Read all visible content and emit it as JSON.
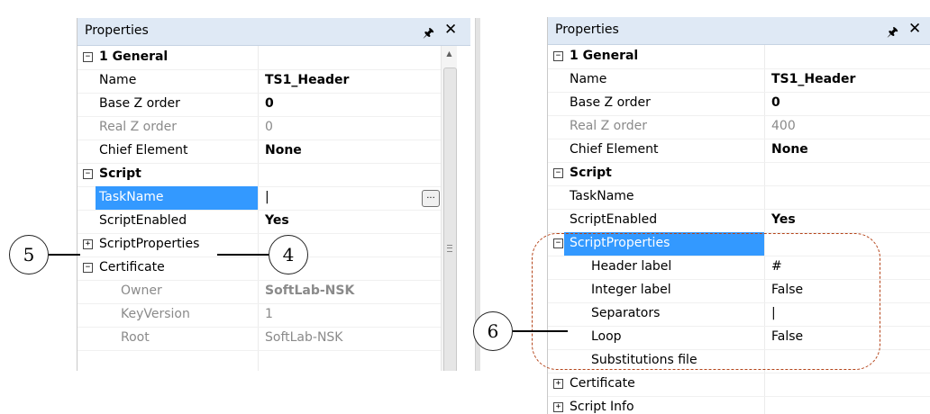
{
  "left_panel": {
    "title": "Properties",
    "pin_icon": "pin-icon",
    "close_icon": "close-icon",
    "rows": [
      {
        "type": "category",
        "name": "1 General",
        "expander": "−"
      },
      {
        "type": "prop",
        "name": "Name",
        "value": "TS1_Header",
        "value_bold": true
      },
      {
        "type": "prop",
        "name": "Base Z order",
        "value": "0",
        "value_bold": true
      },
      {
        "type": "prop",
        "name": "Real Z order",
        "value": "0",
        "grey": true
      },
      {
        "type": "prop",
        "name": "Chief Element",
        "value": "None",
        "value_bold": true
      },
      {
        "type": "category",
        "name": "Script",
        "expander": "−"
      },
      {
        "type": "prop",
        "name": "TaskName",
        "value": "|",
        "selected": true
      },
      {
        "type": "prop",
        "name": "ScriptEnabled",
        "value": "Yes",
        "value_bold": true
      },
      {
        "type": "prop-collapsed",
        "name": "ScriptProperties",
        "expander": "+"
      },
      {
        "type": "group",
        "name": "Certificate",
        "expander": "−"
      },
      {
        "type": "child",
        "name": "Owner",
        "value": "SoftLab-NSK",
        "grey": true,
        "value_bold": true
      },
      {
        "type": "child",
        "name": "KeyVersion",
        "value": "1",
        "grey": true
      },
      {
        "type": "child",
        "name": "Root",
        "value": "SoftLab-NSK",
        "grey": true
      }
    ]
  },
  "right_panel": {
    "title": "Properties",
    "rows": [
      {
        "type": "category",
        "name": "1 General",
        "expander": "−"
      },
      {
        "type": "prop",
        "name": "Name",
        "value": "TS1_Header",
        "value_bold": true
      },
      {
        "type": "prop",
        "name": "Base Z order",
        "value": "0",
        "value_bold": true
      },
      {
        "type": "prop",
        "name": "Real Z order",
        "value": "400",
        "grey": true
      },
      {
        "type": "prop",
        "name": "Chief Element",
        "value": "None",
        "value_bold": true
      },
      {
        "type": "category",
        "name": "Script",
        "expander": "−"
      },
      {
        "type": "prop",
        "name": "TaskName",
        "value": ""
      },
      {
        "type": "prop",
        "name": "ScriptEnabled",
        "value": "Yes",
        "value_bold": true
      },
      {
        "type": "group",
        "name": "ScriptProperties",
        "expander": "−",
        "selected": true
      },
      {
        "type": "child",
        "name": "Header label",
        "value": "#"
      },
      {
        "type": "child",
        "name": "Integer label",
        "value": "False"
      },
      {
        "type": "child",
        "name": "Separators",
        "value": "|"
      },
      {
        "type": "child",
        "name": "Loop",
        "value": "False"
      },
      {
        "type": "child",
        "name": "Substitutions file",
        "value": ""
      },
      {
        "type": "group",
        "name": "Certificate",
        "expander": "+"
      },
      {
        "type": "group",
        "name": "Script Info",
        "expander": "+"
      }
    ]
  },
  "callouts": {
    "four": "4",
    "five": "5",
    "six": "6"
  }
}
